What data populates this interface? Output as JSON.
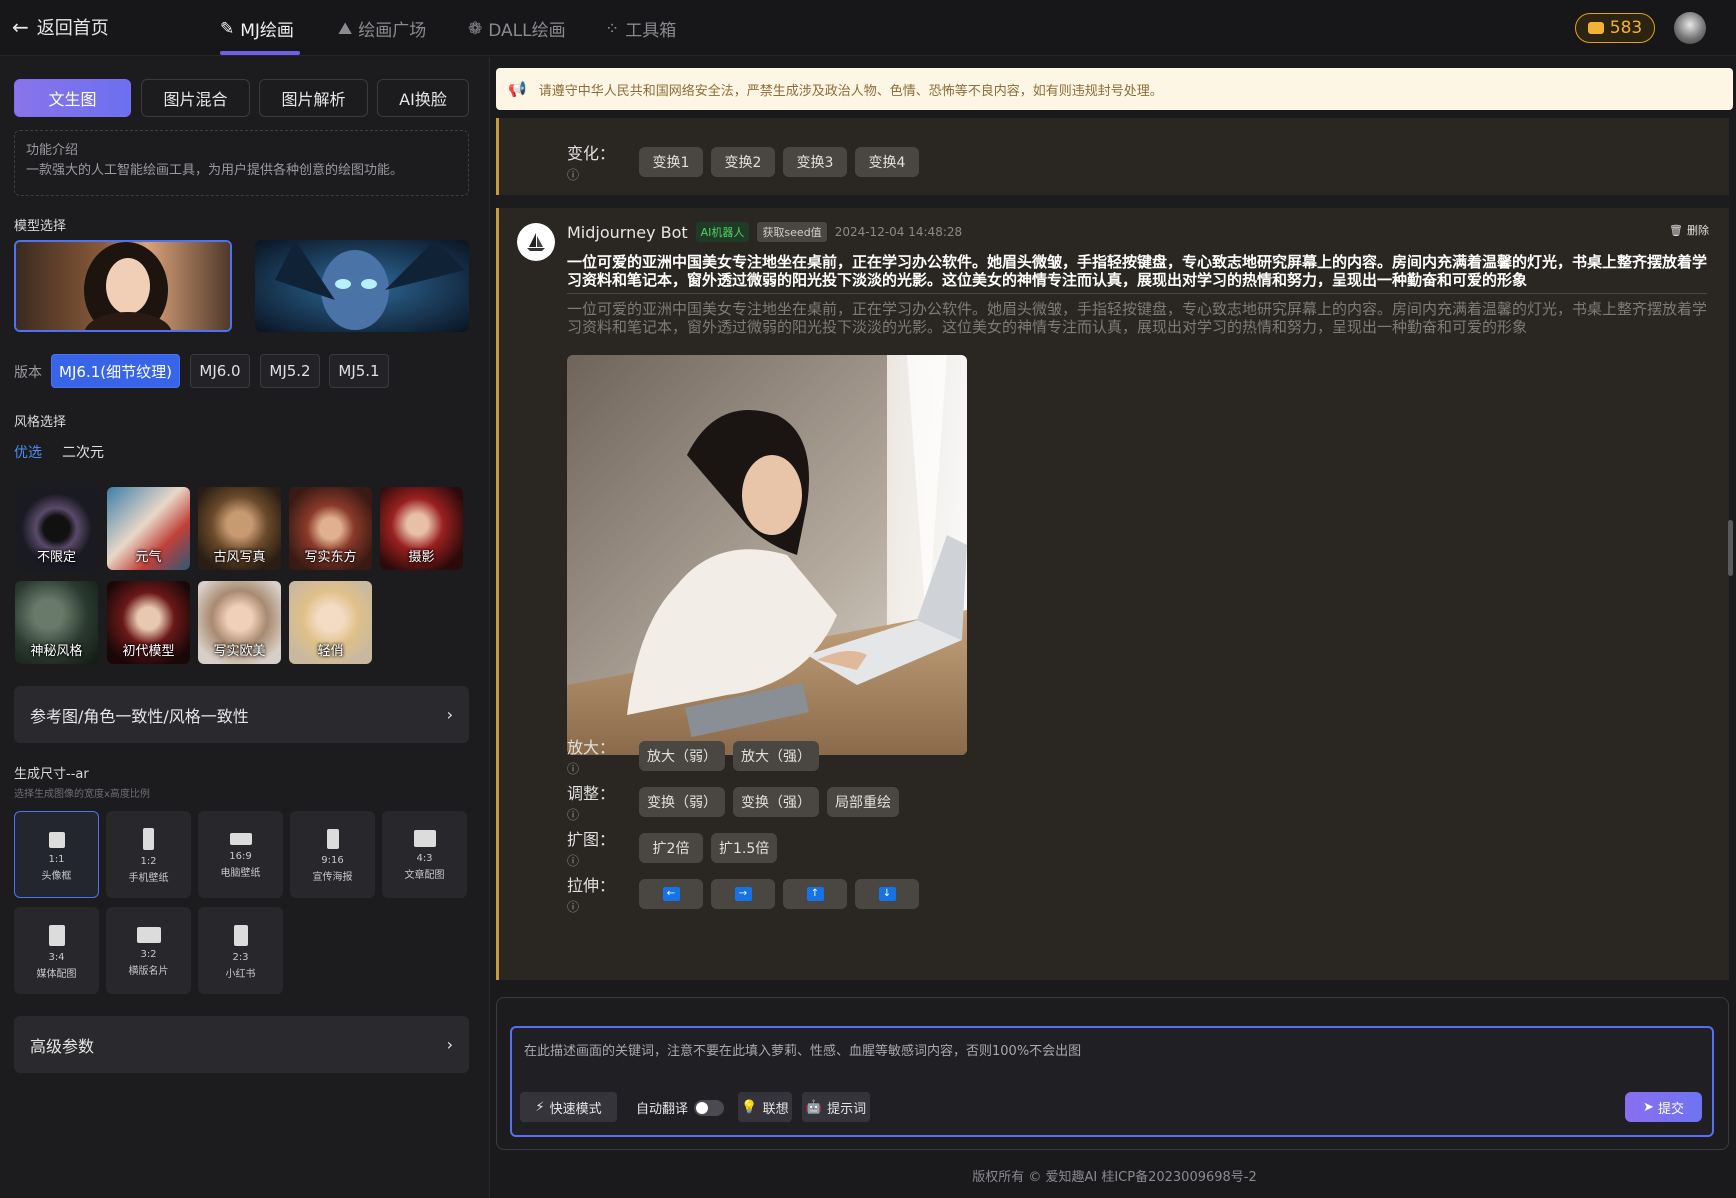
{
  "topbar": {
    "back_label": "返回首页",
    "tabs": [
      {
        "label": "MJ绘画"
      },
      {
        "label": "绘画广场"
      },
      {
        "label": "DALL绘画"
      },
      {
        "label": "工具箱"
      }
    ],
    "credits": "583"
  },
  "sidebar": {
    "mode_tabs": [
      "文生图",
      "图片混合",
      "图片解析",
      "AI换脸"
    ],
    "intro_title": "功能介绍",
    "intro_text": "一款强大的人工智能绘画工具，为用户提供各种创意的绘图功能。",
    "model_section": "模型选择",
    "version_label": "版本",
    "versions": [
      "MJ6.1(细节纹理)",
      "MJ6.0",
      "MJ5.2",
      "MJ5.1"
    ],
    "style_section": "风格选择",
    "style_tabs": [
      "优选",
      "二次元"
    ],
    "styles": [
      "不限定",
      "元气",
      "古风写真",
      "写实东方",
      "摄影",
      "神秘风格",
      "初代模型",
      "写实欧美",
      "轻俏"
    ],
    "reference_label": "参考图/角色一致性/风格一致性",
    "size_section": "生成尺寸--ar",
    "size_hint": "选择生成图像的宽度x高度比例",
    "aspect_ratios": [
      {
        "ratio": "1:1",
        "name": "头像框"
      },
      {
        "ratio": "1:2",
        "name": "手机壁纸"
      },
      {
        "ratio": "16:9",
        "name": "电脑壁纸"
      },
      {
        "ratio": "9:16",
        "name": "宣传海报"
      },
      {
        "ratio": "4:3",
        "name": "文章配图"
      },
      {
        "ratio": "3:4",
        "name": "媒体配图"
      },
      {
        "ratio": "3:2",
        "name": "横版名片"
      },
      {
        "ratio": "2:3",
        "name": "小红书"
      }
    ],
    "advanced_label": "高级参数"
  },
  "notice": "请遵守中华人民共和国网络安全法，严禁生成涉及政治人物、色情、恐怖等不良内容，如有则违规封号处理。",
  "chat": {
    "prev_row_label": "变化：",
    "prev_buttons": [
      "变换1",
      "变换2",
      "变换3",
      "变换4"
    ],
    "bot_name": "Midjourney Bot",
    "bot_badge": "AI机器人",
    "seed_badge": "获取seed值",
    "timestamp": "2024-12-04 14:48:28",
    "delete_label": "删除",
    "prompt_bold": "一位可爱的亚洲中国美女专注地坐在桌前，正在学习办公软件。她眉头微皱，手指轻按键盘，专心致志地研究屏幕上的内容。房间内充满着温馨的灯光，书桌上整齐摆放着学习资料和笔记本，窗外透过微弱的阳光投下淡淡的光影。这位美女的神情专注而认真，展现出对学习的热情和努力，呈现出一种勤奋和可爱的形象",
    "prompt_plain": "一位可爱的亚洲中国美女专注地坐在桌前，正在学习办公软件。她眉头微皱，手指轻按键盘，专心致志地研究屏幕上的内容。房间内充满着温馨的灯光，书桌上整齐摆放着学习资料和笔记本，窗外透过微弱的阳光投下淡淡的光影。这位美女的神情专注而认真，展现出对学习的热情和努力，呈现出一种勤奋和可爱的形象",
    "rows": [
      {
        "label": "放大：",
        "buttons": [
          "放大（弱）",
          "放大（强）"
        ]
      },
      {
        "label": "调整：",
        "buttons": [
          "变换（弱）",
          "变换（强）",
          "局部重绘"
        ]
      },
      {
        "label": "扩图：",
        "buttons": [
          "扩2倍",
          "扩1.5倍"
        ]
      },
      {
        "label": "拉伸：",
        "buttons": [
          "←",
          "→",
          "↑",
          "↓"
        ]
      }
    ]
  },
  "composer": {
    "placeholder": "在此描述画面的关键词，注意不要在此填入萝莉、性感、血腥等敏感词内容，否则100%不会出图",
    "fast_mode": "快速模式",
    "auto_translate": "自动翻译",
    "associate": "联想",
    "prompt_words": "提示词",
    "submit": "提交"
  },
  "footer": "版权所有 © 爱知趣AI 桂ICP备2023009698号-2",
  "colors": {
    "accent": "#6d62e6",
    "selected_blue": "#3864e8",
    "gold": "#c99a3c"
  }
}
